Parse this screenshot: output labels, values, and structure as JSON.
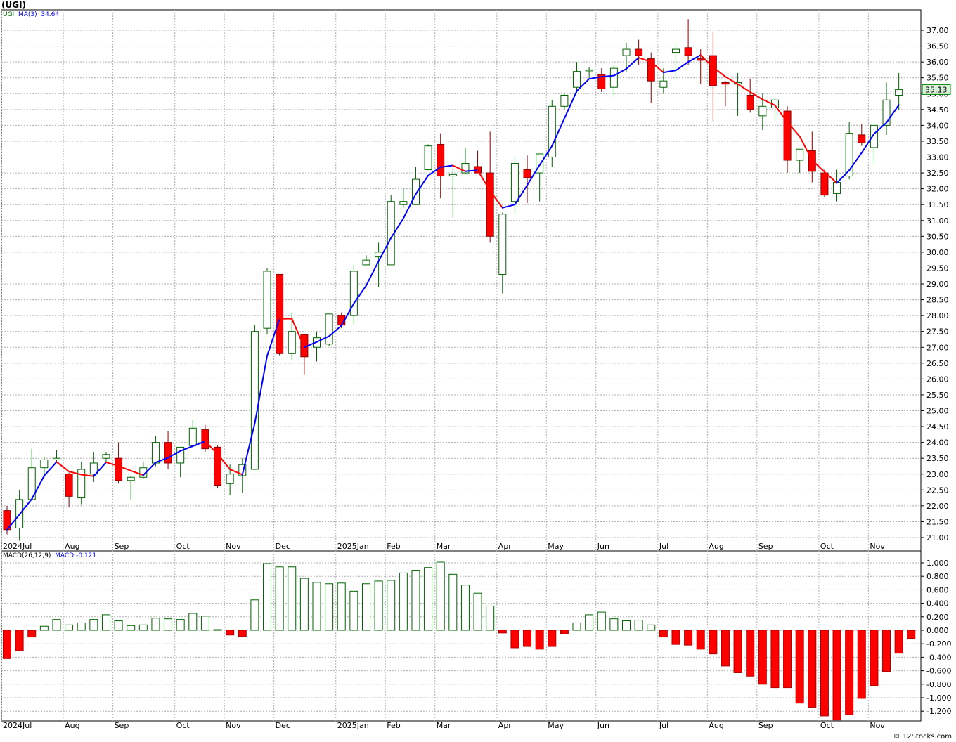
{
  "title": "(UGI)",
  "copyright": "© 12Stocks.com",
  "price_panel": {
    "legend_symbol": "UGI",
    "legend_ma": "MA(3)",
    "legend_ma_value": "34.64",
    "last_price": "35.13"
  },
  "macd_panel": {
    "legend_label": "MACD(26,12,9)",
    "legend_value": "MACD:-0.121"
  },
  "colors": {
    "up_candle": "#006400",
    "down_candle": "#ff0000",
    "ma_up": "#0000ff",
    "ma_down": "#ff0000",
    "grid": "#b0b0b0",
    "price_tag": "#d8f0d8",
    "price_tag_border": "#008000"
  },
  "chart_data": [
    {
      "type": "candlestick",
      "title": "(UGI)",
      "period": "weekly",
      "ylim": [
        20.8,
        37.5
      ],
      "y_ticks": [
        "21.00",
        "21.50",
        "22.00",
        "22.50",
        "23.00",
        "23.50",
        "24.00",
        "24.50",
        "25.00",
        "25.50",
        "26.00",
        "26.50",
        "27.00",
        "27.50",
        "28.00",
        "28.50",
        "29.00",
        "29.50",
        "30.00",
        "30.50",
        "31.00",
        "31.50",
        "32.00",
        "32.50",
        "33.00",
        "33.50",
        "34.00",
        "34.50",
        "35.00",
        "35.50",
        "36.00",
        "36.50",
        "37.00"
      ],
      "x_labels": [
        {
          "label": "2024Jul",
          "week": 0
        },
        {
          "label": "Aug",
          "week": 5
        },
        {
          "label": "Sep",
          "week": 9
        },
        {
          "label": "Oct",
          "week": 14
        },
        {
          "label": "Nov",
          "week": 18
        },
        {
          "label": "Dec",
          "week": 22
        },
        {
          "label": "2025Jan",
          "week": 27
        },
        {
          "label": "Feb",
          "week": 31
        },
        {
          "label": "Mar",
          "week": 35
        },
        {
          "label": "Apr",
          "week": 40
        },
        {
          "label": "May",
          "week": 44
        },
        {
          "label": "Jun",
          "week": 48
        },
        {
          "label": "Jul",
          "week": 53
        },
        {
          "label": "Aug",
          "week": 57
        },
        {
          "label": "Sep",
          "week": 61
        },
        {
          "label": "Oct",
          "week": 66
        },
        {
          "label": "Nov",
          "week": 70
        }
      ],
      "candles": [
        {
          "o": 21.85,
          "h": 22.0,
          "l": 21.1,
          "c": 21.25
        },
        {
          "o": 21.3,
          "h": 22.5,
          "l": 20.9,
          "c": 22.2
        },
        {
          "o": 22.2,
          "h": 23.8,
          "l": 22.2,
          "c": 23.2
        },
        {
          "o": 23.2,
          "h": 23.55,
          "l": 22.9,
          "c": 23.45
        },
        {
          "o": 23.45,
          "h": 23.75,
          "l": 23.35,
          "c": 23.5
        },
        {
          "o": 23.0,
          "h": 23.05,
          "l": 21.95,
          "c": 22.3
        },
        {
          "o": 22.25,
          "h": 23.4,
          "l": 22.05,
          "c": 23.15
        },
        {
          "o": 23.0,
          "h": 23.7,
          "l": 22.75,
          "c": 23.35
        },
        {
          "o": 23.5,
          "h": 23.7,
          "l": 23.35,
          "c": 23.62
        },
        {
          "o": 23.5,
          "h": 24.0,
          "l": 22.7,
          "c": 22.8
        },
        {
          "o": 22.8,
          "h": 22.95,
          "l": 22.2,
          "c": 22.9
        },
        {
          "o": 22.9,
          "h": 23.4,
          "l": 22.85,
          "c": 23.2
        },
        {
          "o": 23.35,
          "h": 24.2,
          "l": 23.25,
          "c": 24.0
        },
        {
          "o": 24.0,
          "h": 24.35,
          "l": 23.15,
          "c": 23.35
        },
        {
          "o": 23.35,
          "h": 23.85,
          "l": 22.9,
          "c": 23.85
        },
        {
          "o": 23.9,
          "h": 24.7,
          "l": 23.85,
          "c": 24.45
        },
        {
          "o": 24.4,
          "h": 24.55,
          "l": 23.7,
          "c": 23.8
        },
        {
          "o": 23.85,
          "h": 23.9,
          "l": 22.55,
          "c": 22.65
        },
        {
          "o": 22.7,
          "h": 23.3,
          "l": 22.35,
          "c": 23.0
        },
        {
          "o": 22.95,
          "h": 23.5,
          "l": 22.4,
          "c": 23.3
        },
        {
          "o": 23.15,
          "h": 27.7,
          "l": 23.15,
          "c": 27.5
        },
        {
          "o": 27.6,
          "h": 29.5,
          "l": 27.4,
          "c": 29.4
        },
        {
          "o": 29.3,
          "h": 29.3,
          "l": 26.75,
          "c": 26.8
        },
        {
          "o": 26.8,
          "h": 28.1,
          "l": 26.6,
          "c": 27.5
        },
        {
          "o": 27.4,
          "h": 27.4,
          "l": 26.15,
          "c": 26.7
        },
        {
          "o": 27.0,
          "h": 27.5,
          "l": 26.55,
          "c": 27.3
        },
        {
          "o": 27.1,
          "h": 28.05,
          "l": 27.05,
          "c": 28.05
        },
        {
          "o": 28.0,
          "h": 28.1,
          "l": 27.6,
          "c": 27.7
        },
        {
          "o": 28.0,
          "h": 29.6,
          "l": 27.7,
          "c": 29.4
        },
        {
          "o": 29.6,
          "h": 29.9,
          "l": 29.6,
          "c": 29.75
        },
        {
          "o": 29.85,
          "h": 30.3,
          "l": 28.9,
          "c": 30.0
        },
        {
          "o": 29.6,
          "h": 31.8,
          "l": 29.6,
          "c": 31.6
        },
        {
          "o": 31.5,
          "h": 32.0,
          "l": 31.4,
          "c": 31.6
        },
        {
          "o": 31.5,
          "h": 32.7,
          "l": 31.5,
          "c": 32.3
        },
        {
          "o": 32.6,
          "h": 33.4,
          "l": 32.6,
          "c": 33.35
        },
        {
          "o": 33.4,
          "h": 33.75,
          "l": 31.7,
          "c": 32.4
        },
        {
          "o": 32.4,
          "h": 32.65,
          "l": 31.1,
          "c": 32.45
        },
        {
          "o": 32.5,
          "h": 33.3,
          "l": 32.45,
          "c": 32.8
        },
        {
          "o": 32.7,
          "h": 33.2,
          "l": 32.5,
          "c": 32.5
        },
        {
          "o": 32.5,
          "h": 33.8,
          "l": 30.3,
          "c": 30.5
        },
        {
          "o": 29.3,
          "h": 31.25,
          "l": 28.7,
          "c": 31.2
        },
        {
          "o": 31.6,
          "h": 33.0,
          "l": 31.2,
          "c": 32.8
        },
        {
          "o": 32.6,
          "h": 33.05,
          "l": 31.55,
          "c": 32.35
        },
        {
          "o": 32.5,
          "h": 33.1,
          "l": 31.6,
          "c": 33.1
        },
        {
          "o": 33.0,
          "h": 34.8,
          "l": 32.7,
          "c": 34.6
        },
        {
          "o": 34.6,
          "h": 35.0,
          "l": 34.5,
          "c": 34.95
        },
        {
          "o": 35.2,
          "h": 36.0,
          "l": 35.0,
          "c": 35.7
        },
        {
          "o": 35.75,
          "h": 35.85,
          "l": 35.5,
          "c": 35.75
        },
        {
          "o": 35.6,
          "h": 35.8,
          "l": 35.05,
          "c": 35.15
        },
        {
          "o": 35.2,
          "h": 35.9,
          "l": 34.9,
          "c": 35.8
        },
        {
          "o": 36.2,
          "h": 36.6,
          "l": 35.7,
          "c": 36.4
        },
        {
          "o": 36.4,
          "h": 36.7,
          "l": 35.9,
          "c": 36.2
        },
        {
          "o": 36.1,
          "h": 36.3,
          "l": 34.7,
          "c": 35.4
        },
        {
          "o": 35.2,
          "h": 35.8,
          "l": 35.0,
          "c": 35.4
        },
        {
          "o": 36.3,
          "h": 36.6,
          "l": 35.5,
          "c": 36.4
        },
        {
          "o": 36.45,
          "h": 37.35,
          "l": 35.9,
          "c": 36.2
        },
        {
          "o": 36.1,
          "h": 36.4,
          "l": 35.3,
          "c": 36.05
        },
        {
          "o": 36.2,
          "h": 36.95,
          "l": 34.1,
          "c": 35.25
        },
        {
          "o": 35.35,
          "h": 35.4,
          "l": 34.6,
          "c": 35.3
        },
        {
          "o": 35.3,
          "h": 35.65,
          "l": 34.3,
          "c": 35.35
        },
        {
          "o": 34.95,
          "h": 35.45,
          "l": 34.4,
          "c": 34.5
        },
        {
          "o": 34.3,
          "h": 35.0,
          "l": 33.85,
          "c": 34.6
        },
        {
          "o": 34.55,
          "h": 34.9,
          "l": 34.1,
          "c": 34.8
        },
        {
          "o": 34.45,
          "h": 34.6,
          "l": 32.5,
          "c": 32.9
        },
        {
          "o": 32.9,
          "h": 33.25,
          "l": 32.5,
          "c": 33.25
        },
        {
          "o": 33.2,
          "h": 33.8,
          "l": 32.2,
          "c": 32.55
        },
        {
          "o": 32.5,
          "h": 32.6,
          "l": 31.75,
          "c": 31.8
        },
        {
          "o": 31.85,
          "h": 32.6,
          "l": 31.6,
          "c": 32.2
        },
        {
          "o": 32.4,
          "h": 34.1,
          "l": 32.3,
          "c": 33.75
        },
        {
          "o": 33.7,
          "h": 34.05,
          "l": 33.35,
          "c": 33.45
        },
        {
          "o": 33.3,
          "h": 34.0,
          "l": 32.8,
          "c": 34.0
        },
        {
          "o": 34.0,
          "h": 35.35,
          "l": 33.7,
          "c": 34.8
        },
        {
          "o": 34.95,
          "h": 35.65,
          "l": 34.5,
          "c": 35.13
        }
      ]
    },
    {
      "type": "bar",
      "title": "MACD(26,12,9)",
      "ylim": [
        -1.3,
        1.1
      ],
      "y_ticks": [
        "1.000",
        "0.800",
        "0.600",
        "0.400",
        "0.200",
        "0.000",
        "-0.200",
        "-0.400",
        "-0.600",
        "-0.800",
        "-1.000",
        "-1.200"
      ],
      "values": [
        -0.42,
        -0.3,
        -0.1,
        0.06,
        0.16,
        0.08,
        0.11,
        0.16,
        0.23,
        0.14,
        0.07,
        0.08,
        0.18,
        0.17,
        0.16,
        0.25,
        0.21,
        0.01,
        -0.07,
        -0.09,
        0.45,
        0.99,
        0.94,
        0.94,
        0.77,
        0.71,
        0.69,
        0.7,
        0.58,
        0.69,
        0.73,
        0.74,
        0.85,
        0.89,
        0.93,
        1.01,
        0.83,
        0.67,
        0.55,
        0.36,
        -0.04,
        -0.26,
        -0.24,
        -0.28,
        -0.24,
        -0.05,
        0.11,
        0.23,
        0.27,
        0.17,
        0.14,
        0.15,
        0.08,
        -0.1,
        -0.21,
        -0.22,
        -0.28,
        -0.35,
        -0.53,
        -0.63,
        -0.68,
        -0.8,
        -0.85,
        -0.85,
        -1.08,
        -1.14,
        -1.27,
        -1.33,
        -1.25,
        -1.01,
        -0.82,
        -0.61,
        -0.34,
        -0.121
      ]
    }
  ]
}
